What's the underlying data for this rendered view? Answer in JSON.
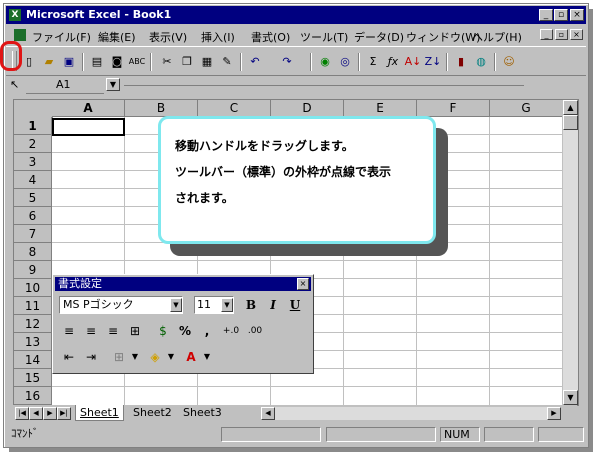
{
  "window": {
    "title": "Microsoft Excel - Book1",
    "minimize": "_",
    "restore": "▫",
    "close": "×"
  },
  "menu": {
    "items": [
      "ファイル(F)",
      "編集(E)",
      "表示(V)",
      "挿入(I)",
      "書式(O)",
      "ツール(T)",
      "データ(D)",
      "ウィンドウ(W)",
      "ヘルプ(H)"
    ]
  },
  "toolbar": {
    "icons": [
      "new-icon",
      "open-icon",
      "save-icon",
      "print-icon",
      "print-preview-icon",
      "spelling-icon",
      "cut-icon",
      "copy-icon",
      "paste-icon",
      "format-painter-icon",
      "undo-icon",
      "redo-icon",
      "hyperlink-icon",
      "web-toolbar-icon",
      "autosum-icon",
      "function-icon",
      "sort-ascending-icon",
      "sort-descending-icon",
      "chart-wizard-icon",
      "map-icon",
      "office-assistant-icon"
    ]
  },
  "formula_bar": {
    "name_box": "A1"
  },
  "sheet": {
    "columns": [
      "A",
      "B",
      "C",
      "D",
      "E",
      "F",
      "G"
    ],
    "rows": [
      "1",
      "2",
      "3",
      "4",
      "5",
      "6",
      "7",
      "8",
      "9",
      "10",
      "11",
      "12",
      "13",
      "14",
      "15",
      "16"
    ],
    "active_cell": "A1"
  },
  "callout": {
    "line1": "移動ハンドルをドラッグします。",
    "line2": "ツールバー（標準）の外枠が点線で表示",
    "line3": "されます。"
  },
  "format_toolbar": {
    "title": "書式設定",
    "font": "MS Pゴシック",
    "size": "11",
    "bold": "B",
    "italic": "I",
    "underline": "U",
    "percent": "%",
    "comma": ",",
    "increase_decimal": "+.0",
    "decrease_decimal": ".00"
  },
  "tabs": [
    "Sheet1",
    "Sheet2",
    "Sheet3"
  ],
  "active_tab": "Sheet1",
  "status": {
    "mode": "ｺﾏﾝﾄﾞ",
    "num": "NUM"
  },
  "colors": {
    "title_bar": "#000080",
    "callout_border": "#7fe8ee",
    "highlight_circle": "#e01515"
  }
}
